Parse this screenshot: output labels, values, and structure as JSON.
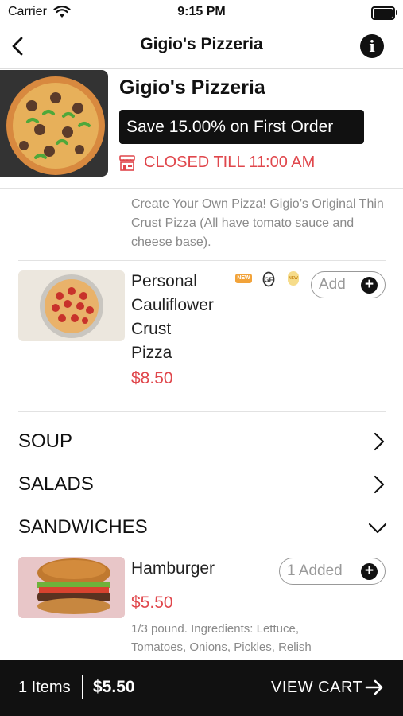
{
  "status_bar": {
    "carrier": "Carrier",
    "time": "9:15 PM"
  },
  "nav": {
    "title": "Gigio's Pizzeria",
    "back_icon": "chevron-left-icon",
    "info_icon": "info-icon"
  },
  "restaurant": {
    "name": "Gigio's Pizzeria",
    "promo": "Save 15.00% on First Order",
    "status": "CLOSED TILL 11:00 AM",
    "status_color": "#e0474c"
  },
  "section": {
    "description": "Create Your Own Pizza! Gigio’s Original Thin Crust Pizza (All have tomato sauce and cheese base)."
  },
  "item_pizza": {
    "name_lines": [
      "Personal",
      "Cauliflower",
      "Crust",
      "Pizza"
    ],
    "price": "$8.50",
    "button": "Add",
    "badges": [
      "NEW",
      "GF",
      "NEW"
    ]
  },
  "categories": [
    {
      "label": "SOUP",
      "state": "collapsed"
    },
    {
      "label": "SALADS",
      "state": "collapsed"
    },
    {
      "label": "SANDWICHES",
      "state": "expanded"
    }
  ],
  "item_burger": {
    "name": "Hamburger",
    "price": "$5.50",
    "button": "1 Added",
    "description_lines": [
      "1/3 pound. Ingredients: Lettuce,",
      "Tomatoes, Onions, Pickles, Relish"
    ]
  },
  "cart": {
    "count": "1 Items",
    "total": "$5.50",
    "view": "VIEW CART"
  },
  "colors": {
    "accent_red": "#e0474c",
    "bar_black": "#111111"
  }
}
